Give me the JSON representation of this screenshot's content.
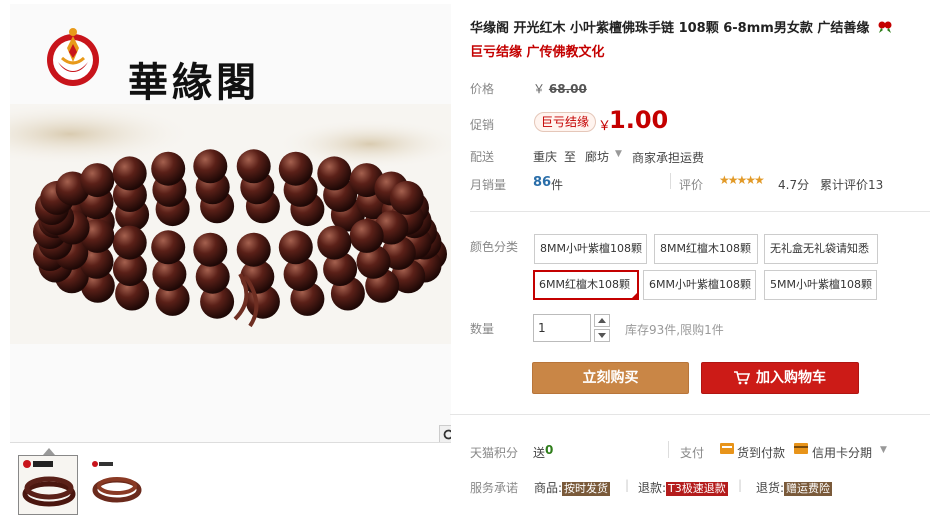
{
  "brand": {
    "name": "華緣閣"
  },
  "gallery": {
    "zoom_icon": "magnifier-icon",
    "thumbnails": [
      "thumbnail-1",
      "thumbnail-2"
    ]
  },
  "product": {
    "title": "华缘阁 开光红木 小叶紫檀佛珠手链 108颗 6-8mm男女款 广结善缘",
    "subtitle": "巨亏结缘 广传佛教文化"
  },
  "price": {
    "label": "价格",
    "original": "￥",
    "original_value": "68.00"
  },
  "promo": {
    "label": "促销",
    "tag": "巨亏结缘",
    "yen": "￥",
    "price": "1.00"
  },
  "shipping": {
    "label": "配送",
    "from": "重庆",
    "to": "至",
    "dest": "廊坊",
    "fee": "商家承担运费"
  },
  "sales": {
    "label": "月销量",
    "count": "86",
    "unit": "件",
    "review_label": "评价",
    "stars": "★★★★★",
    "rating_value": 4.7,
    "rating": "4.7分",
    "review_count": "累计评价13"
  },
  "sku": {
    "label": "颜色分类",
    "options": [
      "8MM小叶紫檀108颗",
      "8MM红檀木108颗",
      "无礼盒无礼袋请知悉",
      "6MM红檀木108颗",
      "6MM小叶紫檀108颗",
      "5MM小叶紫檀108颗"
    ],
    "selected_index": 3
  },
  "quantity": {
    "label": "数量",
    "value": "1",
    "stock": "库存93件,限购1件"
  },
  "actions": {
    "buy_now": "立刻购买",
    "add_cart": "加入购物车"
  },
  "points": {
    "label": "天猫积分",
    "send": "送",
    "value": "0"
  },
  "payment": {
    "label": "支付",
    "cod": "货到付款",
    "credit": "信用卡分期"
  },
  "service": {
    "label": "服务承诺",
    "items": [
      {
        "prefix": "商品:",
        "tag": "按时发货"
      },
      {
        "prefix": "退款:",
        "tag": "T3极速退款"
      },
      {
        "prefix": "退货:",
        "tag": "赠运费险"
      }
    ]
  },
  "colors": {
    "accent_red": "#c40000",
    "buy_now_bg": "#c98646",
    "add_cart_bg": "#cc1b17",
    "link_blue": "#2a6ea9"
  }
}
